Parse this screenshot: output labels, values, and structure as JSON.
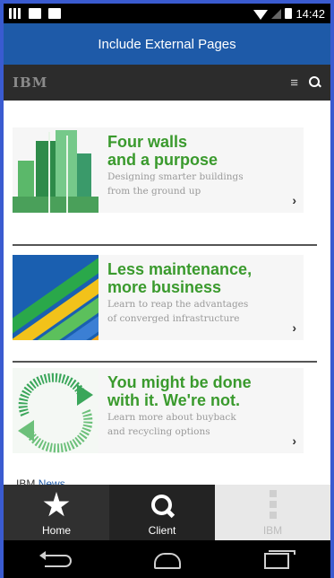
{
  "status_bar": {
    "time": "14:42"
  },
  "title_bar": {
    "title": "Include External Pages"
  },
  "ibm_header": {
    "logo": "IBM"
  },
  "promos": [
    {
      "title_line1": "Four walls",
      "title_line2": "and a purpose",
      "subtitle_line1": "Designing smarter buildings",
      "subtitle_line2": "from the ground up",
      "arrow": "›"
    },
    {
      "title_line1": "Less maintenance,",
      "title_line2": "more business",
      "subtitle_line1": "Learn to reap the advantages",
      "subtitle_line2": "of converged infrastructure",
      "arrow": "›"
    },
    {
      "title_line1": "You might be done",
      "title_line2": "with it. We're not.",
      "subtitle_line1": "Learn more about buyback",
      "subtitle_line2": "and recycling options",
      "arrow": "›"
    }
  ],
  "news": {
    "brand": "IBM",
    "label": "News"
  },
  "tabs": [
    {
      "label": "Home",
      "icon": "star-icon"
    },
    {
      "label": "Client",
      "icon": "search-icon"
    },
    {
      "label": "IBM",
      "icon": "more-icon"
    }
  ],
  "colors": {
    "title_bar": "#1e5aa8",
    "promo_title": "#3a9a2d",
    "ibm_bar": "#2c2c2c"
  }
}
